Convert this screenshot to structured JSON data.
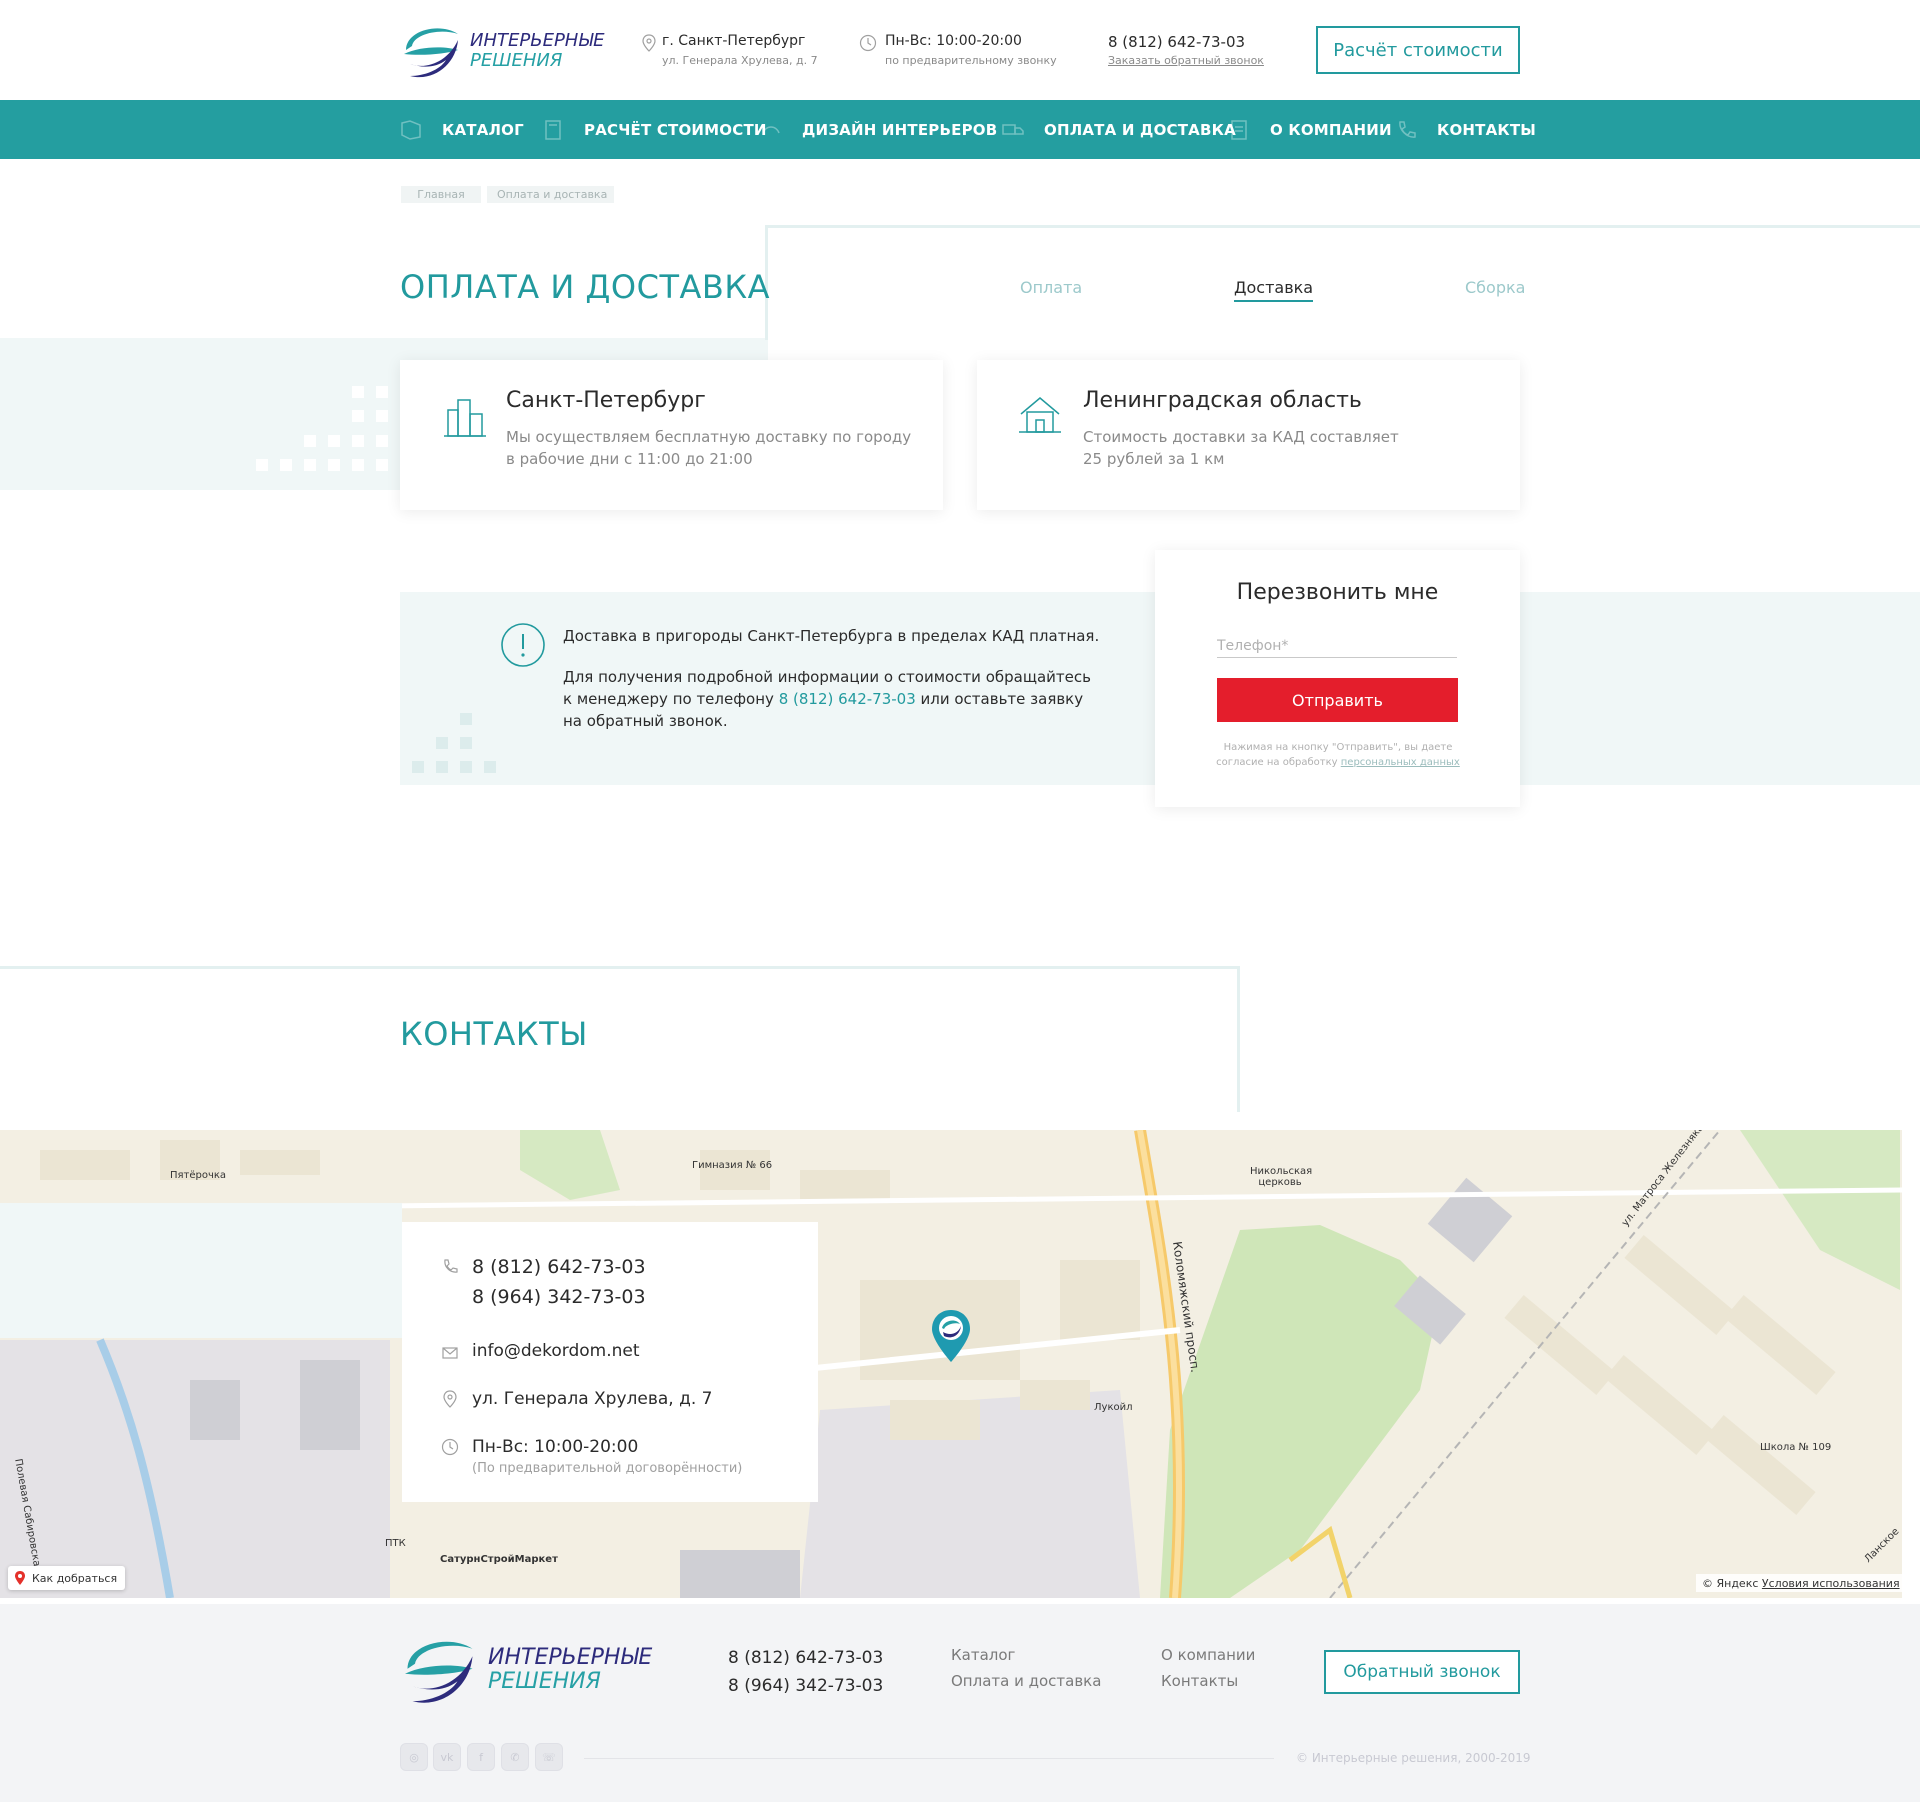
{
  "header": {
    "logo_line1": "ИНТЕРЬЕРНЫЕ",
    "logo_line2": "РЕШЕНИЯ",
    "city": "г. Санкт-Петербург",
    "address": "ул. Генерала Хрулева, д. 7",
    "hours": "Пн-Вс: 10:00-20:00",
    "hours_note": "по предварительному звонку",
    "phone": "8 (812) 642-73-03",
    "callback_link": "Заказать обратный звонок",
    "cta_button": "Расчёт стоимости"
  },
  "nav": {
    "items": [
      {
        "label": "КАТАЛОГ",
        "icon": "catalog-icon"
      },
      {
        "label": "РАСЧЁТ СТОИМОСТИ",
        "icon": "calculator-icon"
      },
      {
        "label": "ДИЗАЙН ИНТЕРЬЕРОВ",
        "icon": "design-icon"
      },
      {
        "label": "ОПЛАТА И ДОСТАВКА",
        "icon": "truck-icon"
      },
      {
        "label": "О КОМПАНИИ",
        "icon": "document-icon"
      },
      {
        "label": "КОНТАКТЫ",
        "icon": "phone-icon"
      }
    ]
  },
  "breadcrumb": {
    "home": "Главная",
    "current": "Оплата и доставка"
  },
  "delivery": {
    "title": "ОПЛАТА И ДОСТАВКА",
    "tabs": [
      "Оплата",
      "Доставка",
      "Сборка"
    ],
    "active_tab": "Доставка",
    "cards": [
      {
        "title": "Санкт-Петербург",
        "text": "Мы осуществляем бесплатную доставку по городу в рабочие дни с 11:00 до 21:00",
        "icon": "city-buildings-icon"
      },
      {
        "title": "Ленинградская область",
        "text": "Стоимость доставки за КАД составляет 25 рублей за 1 км",
        "icon": "house-icon"
      }
    ],
    "info_line1": "Доставка в пригороды Санкт-Петербурга в пределах КАД платная.",
    "info_line2_before": "Для получения подробной информации о стоимости обращайтесь к менеджеру по телефону",
    "info_phone": "8 (812) 642-73-03",
    "info_line2_after": "или оставьте заявку на обратный звонок."
  },
  "callback_form": {
    "title": "Перезвонить мне",
    "phone_placeholder": "Телефон*",
    "submit": "Отправить",
    "note_before": "Нажимая на кнопку \"Отправить\", вы даете согласие на обработку",
    "note_link": "персональных данных"
  },
  "contacts": {
    "title": "КОНТАКТЫ",
    "phone1": "8 (812) 642-73-03",
    "phone2": "8 (964) 342-73-03",
    "email": "info@dekordom.net",
    "address": "ул. Генерала Хрулева, д. 7",
    "hours": "Пн-Вс: 10:00-20:00",
    "hours_note": "(По предварительной договорённости)"
  },
  "map": {
    "labels": {
      "pyaterochka": "Пятёрочка",
      "gymnasium": "Гимназия № 66",
      "church": "Никольская церковь",
      "street_kolomyazh": "Коломяжский просп.",
      "street_matrosa": "ул. Матроса Железняка",
      "lukoil": "Лукойл",
      "school": "Школа № 109",
      "ptk": "ПТК",
      "saturn": "СатурнСтройМаркет",
      "polevaya": "Полевая Сабировская",
      "lanskoe": "Ланское",
      "route_button": "Как добраться",
      "yandex": "© Яндекс",
      "terms": "Условия использования"
    }
  },
  "footer": {
    "logo_line1": "ИНТЕРЬЕРНЫЕ",
    "logo_line2": "РЕШЕНИЯ",
    "phone1": "8 (812) 642-73-03",
    "phone2": "8 (964) 342-73-03",
    "links_col1": [
      "Каталог",
      "Оплата и доставка"
    ],
    "links_col2": [
      "О компании",
      "Контакты"
    ],
    "callback_button": "Обратный звонок",
    "socials": [
      "instagram-icon",
      "vk-icon",
      "facebook-icon",
      "whatsapp-icon",
      "viber-icon"
    ],
    "copyright": "© Интерьерные решения, 2000-2019"
  },
  "colors": {
    "accent": "#249ea0",
    "brand_dark": "#2d2b7c",
    "button_red": "#e41e2c",
    "light_teal_bg": "#f0f7f7"
  }
}
